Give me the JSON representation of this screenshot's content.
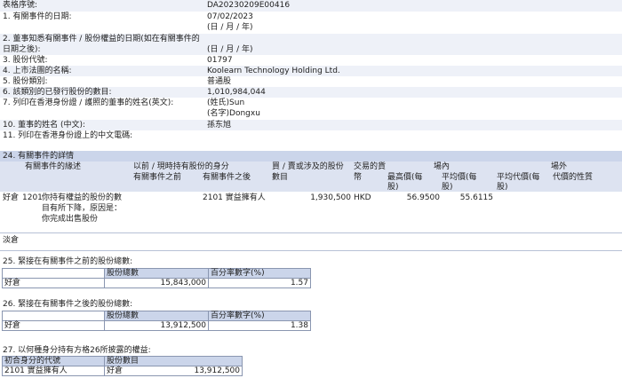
{
  "rows": [
    {
      "label": "表格序號:",
      "value": "DA20230209E00416"
    },
    {
      "label": "1. 有關事件的日期:",
      "value": "07/02/2023",
      "value2": "(日 / 月 / 年)"
    },
    {
      "label": "2. 董事知悉有關事件 / 股份權益的日期(如在有關事件的",
      "label2": "日期之後):",
      "value": "(日 / 月 / 年)"
    },
    {
      "label": "3. 股份代號:",
      "value": "01797"
    },
    {
      "label": "4. 上市法團的名稱:",
      "value": "Koolearn Technology Holding Ltd."
    },
    {
      "label": "5. 股份類別:",
      "value": "普通股"
    },
    {
      "label": "6. 該類別的已發行股份的數目:",
      "value": "1,010,984,044"
    },
    {
      "label": "7. 列印在香港身份證 / 護照的董事的姓名(英文):",
      "value": "(姓氏)Sun",
      "value2": "(名字)Dongxu"
    },
    {
      "label": "10. 董事的姓名 (中文):",
      "value": "孫东旭"
    },
    {
      "label": "11. 列印在香港身份證上的中文電碼:",
      "value": ""
    }
  ],
  "s24": {
    "title": "24. 有關事件的詳情",
    "h_reason": "有關事件的緣述",
    "h_capacity1": "以前 / 現時持有股份的身分",
    "h_before": "有關事件之前",
    "h_after": "有關事件之後",
    "h_shares": "買 / 賣或涉及的股份",
    "h_shares2": "數目",
    "h_currency": "交易的貨",
    "h_currency2": "幣",
    "h_onmarket": "場內",
    "h_high": "最高價(每",
    "h_high2": "股)",
    "h_avg": "平均價(每",
    "h_avg2": "股)",
    "h_offmarket": "場外",
    "h_avgcons": "平均代價(每",
    "h_avgcons2": "股)",
    "h_nature": "代價的性質",
    "pos": "好倉",
    "code": "1201",
    "reason1": "你持有權益的股份的數",
    "reason2": "目有所下降，原因是：",
    "reason3": "你完成出售股份",
    "cap_after": "2101 實益擁有人",
    "shares": "1,930,500",
    "currency": "HKD",
    "high": "56.9500",
    "avg": "55.6115",
    "short": "淡倉"
  },
  "s25": {
    "title": "25. 緊接在有關事件之前的股份總數:",
    "h_shares": "股份總數",
    "h_pct": "百分率數字(%)",
    "row_label": "好倉",
    "shares": "15,843,000",
    "pct": "1.57"
  },
  "s26": {
    "title": "26. 緊接在有關事件之後的股份總數:",
    "h_shares": "股份總數",
    "h_pct": "百分率數字(%)",
    "row_label": "好倉",
    "shares": "13,912,500",
    "pct": "1.38"
  },
  "s27": {
    "title": "27. 以何種身分持有方格26所披露的權益:",
    "h_capacity": "初合身分的代號",
    "h_shares": "股份數目",
    "capacity": "2101 實益擁有人",
    "pos": "好倉",
    "shares": "13,912,500"
  },
  "colors": {
    "band": "#eef1f8",
    "header": "#cbd5ea",
    "border": "#8a96b0"
  }
}
